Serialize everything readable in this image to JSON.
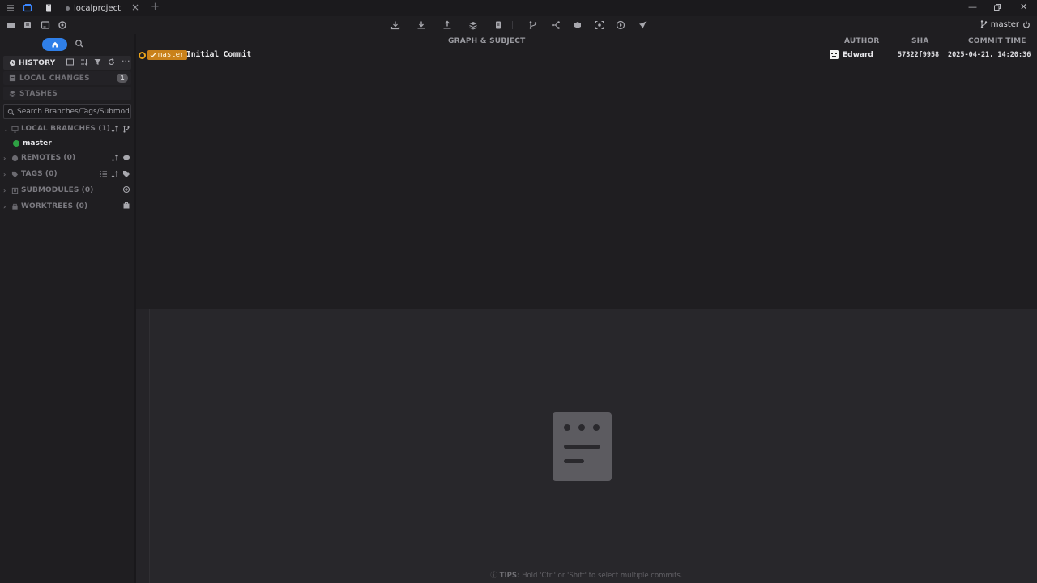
{
  "tab": {
    "title": "localproject"
  },
  "header": {
    "current_branch": "master"
  },
  "sidebar": {
    "history_label": "HISTORY",
    "local_changes": {
      "label": "LOCAL CHANGES",
      "count": "1"
    },
    "stashes_label": "STASHES",
    "search_placeholder": "Search Branches/Tags/Submodules",
    "local_branches": {
      "label": "LOCAL BRANCHES (1)",
      "branches": [
        "master"
      ]
    },
    "remotes_label": "REMOTES (0)",
    "tags_label": "TAGS (0)",
    "submodules_label": "SUBMODULES (0)",
    "worktrees_label": "WORKTREES (0)"
  },
  "commits": {
    "columns": {
      "graph": "GRAPH & SUBJECT",
      "author": "AUTHOR",
      "sha": "SHA",
      "time": "COMMIT TIME"
    },
    "rows": [
      {
        "ref": "master",
        "subject": "Initial Commit",
        "author": "Edward",
        "sha": "57322f9958",
        "time": "2025-04-21, 14:20:36"
      }
    ]
  },
  "detail": {
    "tip_prefix": "TIPS:",
    "tip_text": "Hold 'Ctrl' or 'Shift' to select multiple commits."
  },
  "colors": {
    "accent": "#2f7fe8",
    "ref_tag": "#c9811a",
    "graph_node": "#e8a21a",
    "branch_dot": "#2ea043"
  }
}
